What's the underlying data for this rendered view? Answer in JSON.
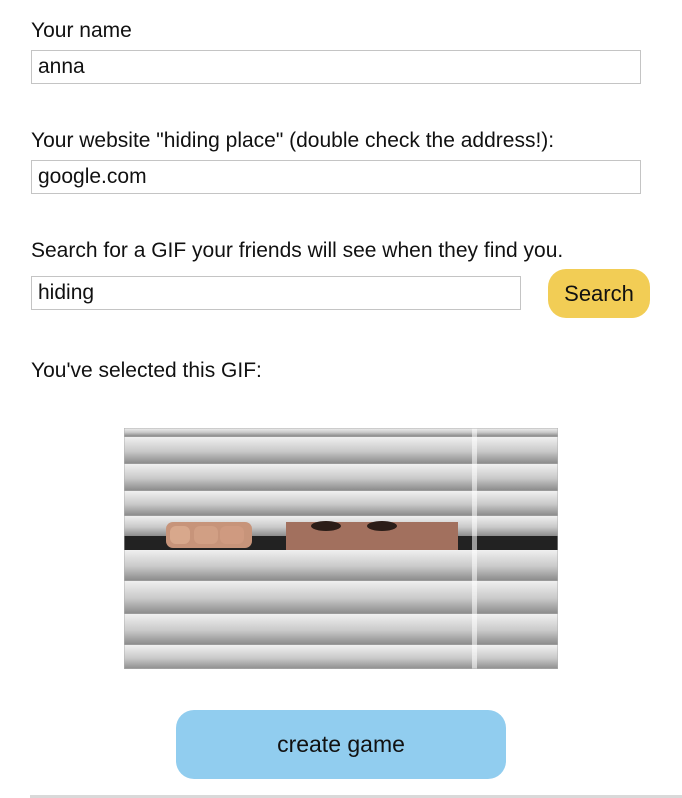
{
  "form": {
    "name_label": "Your name",
    "name_value": "anna",
    "website_label": "Your website \"hiding place\" (double check the address!):",
    "website_value": "google.com",
    "search_label": "Search for a GIF your friends will see when they find you.",
    "search_value": "hiding",
    "search_button": "Search",
    "selected_label": "You've selected this GIF:",
    "create_button": "create game"
  },
  "colors": {
    "search_button": "#f2cd55",
    "create_button": "#91cdef",
    "input_border": "#c4c4c4"
  },
  "icons": {
    "gif": "peeking-through-blinds-gif"
  }
}
